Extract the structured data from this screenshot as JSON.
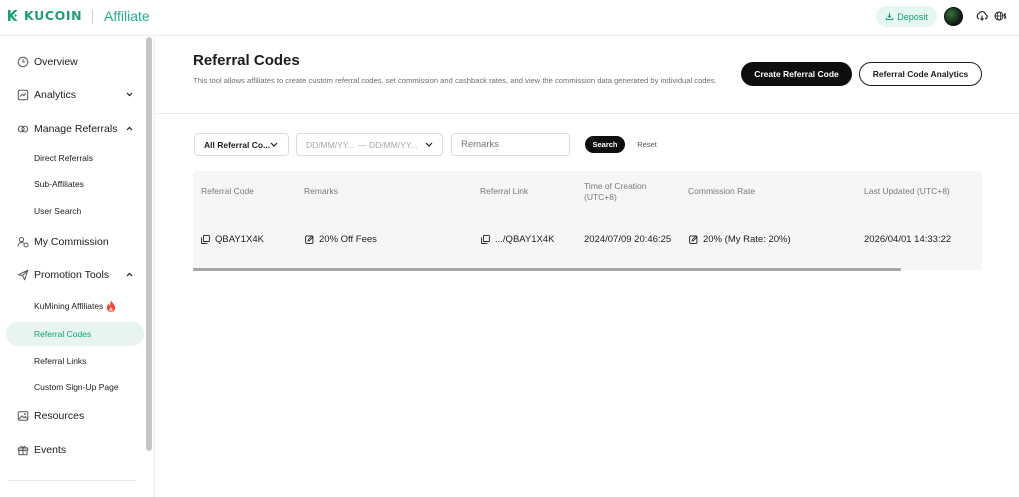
{
  "header": {
    "logo_text": "KUCOIN",
    "subtitle": "Affiliate",
    "deposit_label": "Deposit",
    "brand_color": "#1d9e74"
  },
  "sidebar": {
    "overview": "Overview",
    "analytics": "Analytics",
    "manage_referrals": "Manage Referrals",
    "direct_referrals": "Direct Referrals",
    "sub_affiliates": "Sub-Affiliates",
    "user_search": "User Search",
    "my_commission": "My Commission",
    "promotion_tools": "Promotion Tools",
    "kumining_affiliates": "KuMining Affiliates",
    "referral_codes": "Referral Codes",
    "referral_links": "Referral Links",
    "custom_signup_page": "Custom Sign-Up Page",
    "resources": "Resources",
    "events": "Events"
  },
  "main": {
    "title": "Referral Codes",
    "description": "This tool allows affiliates to create custom referral codes, set commission and cashback rates, and view the commission data generated by individual codes.",
    "create_button": "Create Referral Code",
    "analytics_button": "Referral Code Analytics"
  },
  "filters": {
    "code_select": "All Referral Co...",
    "date_from": "DD/MM/YY...",
    "date_sep": "—",
    "date_to": "DD/MM/YY...",
    "remarks_placeholder": "Remarks",
    "search_button": "Search",
    "reset_button": "Reset"
  },
  "table": {
    "headers": {
      "code": "Referral Code",
      "remarks": "Remarks",
      "link": "Referral Link",
      "created_1": "Time of Creation",
      "created_2": "(UTC+8)",
      "commission": "Commission Rate",
      "updated": "Last Updated (UTC+8)"
    },
    "rows": [
      {
        "code": "QBAY1X4K",
        "remarks": "20% Off Fees",
        "link": ".../QBAY1X4K",
        "created": "2024/07/09 20:46:25",
        "commission": "20% (My Rate: 20%)",
        "updated": "2026/04/01 14:33:22"
      }
    ]
  }
}
